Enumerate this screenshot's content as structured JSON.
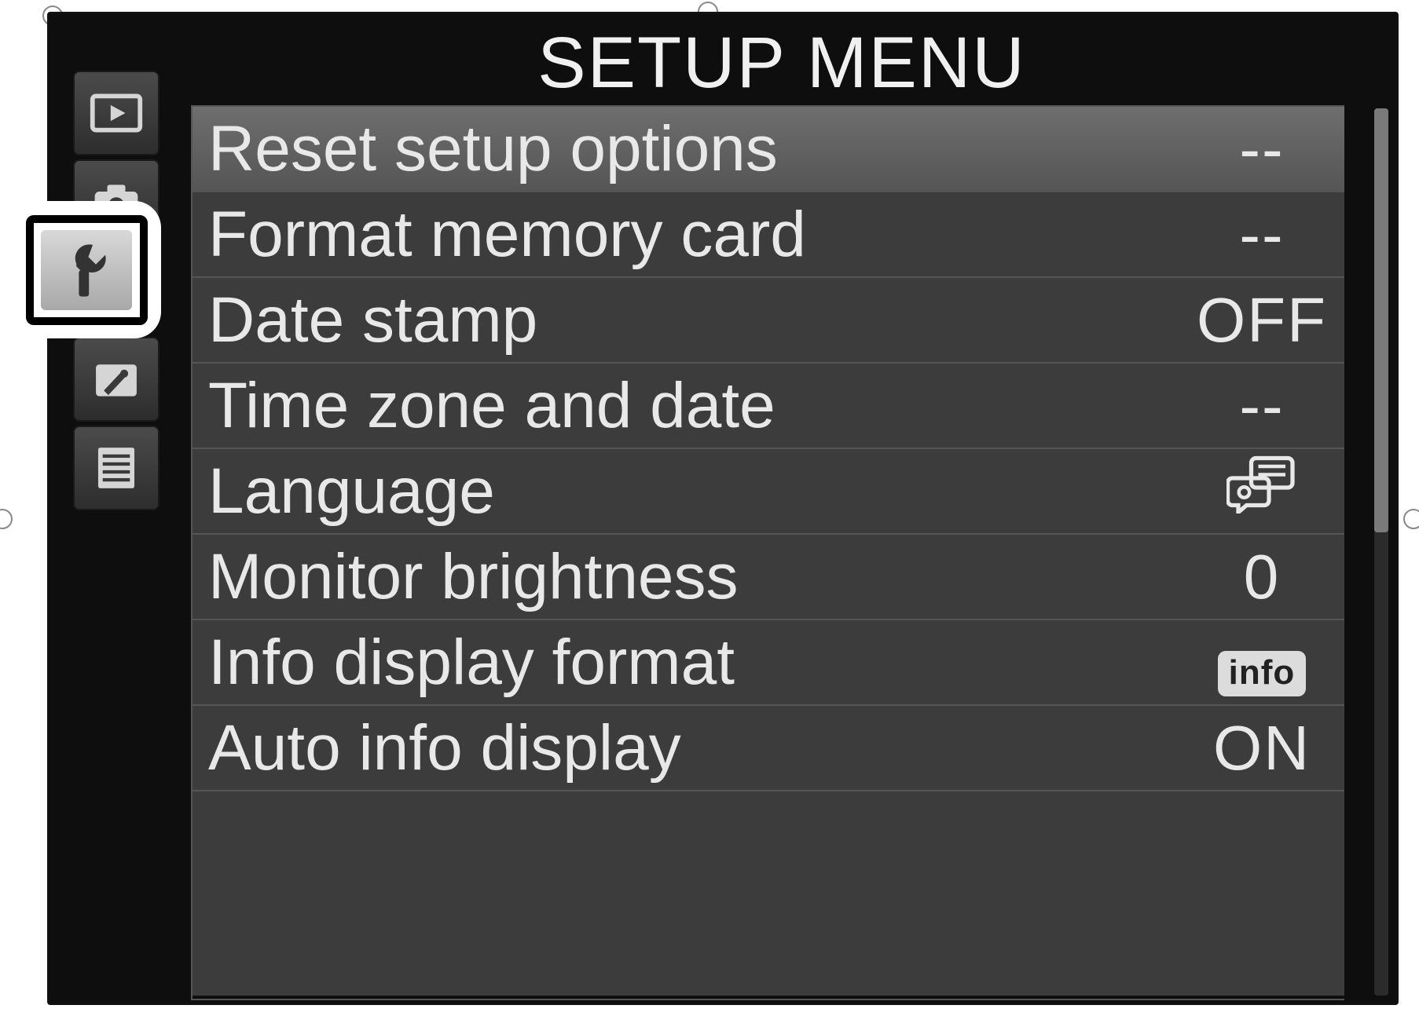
{
  "header": {
    "title": "SETUP MENU"
  },
  "sidebar": {
    "tabs": [
      {
        "name": "playback-tab",
        "icon": "play-icon"
      },
      {
        "name": "shooting-tab",
        "icon": "camera-icon"
      },
      {
        "name": "setup-tab",
        "icon": "wrench-icon",
        "selected": true
      },
      {
        "name": "retouch-tab",
        "icon": "brush-icon"
      },
      {
        "name": "recent-tab",
        "icon": "list-icon"
      }
    ]
  },
  "menu": {
    "items": [
      {
        "label": "Reset setup options",
        "value": "--",
        "selected": true
      },
      {
        "label": "Format memory card",
        "value": "--",
        "selected": false
      },
      {
        "label": "Date stamp",
        "value": "OFF",
        "selected": false
      },
      {
        "label": "Time zone and date",
        "value": "--",
        "selected": false
      },
      {
        "label": "Language",
        "value_icon": "language-icon",
        "selected": false
      },
      {
        "label": "Monitor brightness",
        "value": "0",
        "selected": false
      },
      {
        "label": "Info display format",
        "value_badge": "info",
        "selected": false
      },
      {
        "label": "Auto info display",
        "value": "ON",
        "selected": false
      }
    ]
  }
}
